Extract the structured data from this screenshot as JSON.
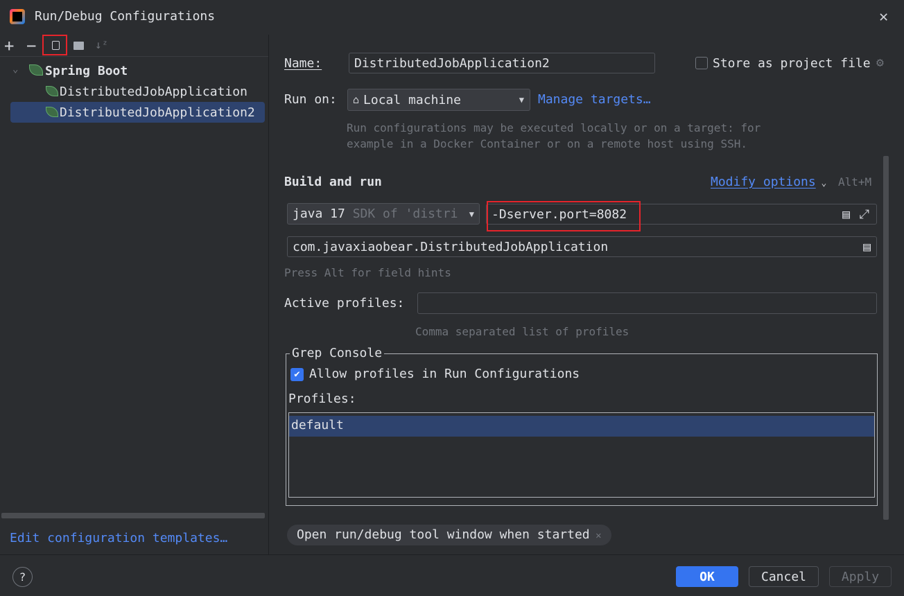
{
  "window": {
    "title": "Run/Debug Configurations"
  },
  "toolbar": {
    "icons": [
      "add-icon",
      "remove-icon",
      "copy-icon",
      "new-folder-icon",
      "sort-icon"
    ]
  },
  "tree": {
    "group": "Spring Boot",
    "items": [
      "DistributedJobApplication",
      "DistributedJobApplication2"
    ],
    "selected": 1
  },
  "left_footer": {
    "templates_link": "Edit configuration templates…"
  },
  "form": {
    "name_label": "Name:",
    "name_value": "DistributedJobApplication2",
    "store_label": "Store as project file",
    "store_checked": false,
    "run_on_label": "Run on:",
    "run_on_value": "Local machine",
    "manage_targets": "Manage targets…",
    "run_on_hint_1": "Run configurations may be executed locally or on a target: for",
    "run_on_hint_2": "example in a Docker Container or on a remote host using SSH.",
    "build_run_title": "Build and run",
    "modify_options": "Modify options",
    "modify_shortcut": "Alt+M",
    "sdk_main": "java 17",
    "sdk_hint": "SDK of 'distri",
    "vm_options": "-Dserver.port=8082",
    "main_class": "com.javaxiaobear.DistributedJobApplication",
    "field_hint": "Press Alt for field hints",
    "profiles_label": "Active profiles:",
    "profiles_value": "",
    "profiles_hint": "Comma separated list of profiles",
    "grep_title": "Grep Console",
    "allow_profiles": "Allow profiles in Run Configurations",
    "allow_checked": true,
    "profiles_list_label": "Profiles:",
    "profiles_list": [
      "default"
    ],
    "tag": "Open run/debug tool window when started"
  },
  "footer": {
    "help": "?",
    "ok": "OK",
    "cancel": "Cancel",
    "apply": "Apply"
  },
  "colors": {
    "accent": "#3574f0",
    "selection": "#2e436e",
    "highlight_box": "#e5242b"
  }
}
